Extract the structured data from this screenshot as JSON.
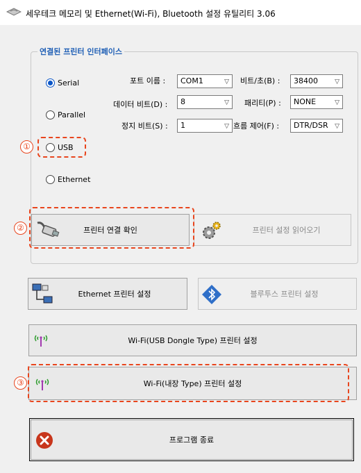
{
  "window": {
    "title": "세우테크 메모리 및 Ethernet(Wi-Fi), Bluetooth 설정 유틸리티 3.06"
  },
  "group": {
    "title": "연결된 프린터 인터페이스",
    "radios": [
      {
        "label": "Serial",
        "checked": true
      },
      {
        "label": "Parallel",
        "checked": false
      },
      {
        "label": "USB",
        "checked": false
      },
      {
        "label": "Ethernet",
        "checked": false
      }
    ],
    "fields": {
      "port": {
        "label": "포트 이름 :",
        "value": "COM1"
      },
      "baud": {
        "label": "비트/초(B) :",
        "value": "38400"
      },
      "databits": {
        "label": "데이터 비트(D) :",
        "value": "8"
      },
      "parity": {
        "label": "패리티(P) :",
        "value": "NONE"
      },
      "stopbits": {
        "label": "정지 비트(S) :",
        "value": "1"
      },
      "flow": {
        "label": "흐름 제어(F) :",
        "value": "DTR/DSR"
      }
    },
    "check_btn": "프린터 연결 확인",
    "read_btn": "프린터 설정 읽어오기"
  },
  "buttons": {
    "ethernet": "Ethernet 프린터 설정",
    "bluetooth": "블루투스 프린터 설정",
    "wifi_usb": "Wi-Fi(USB Dongle Type) 프린터 설정",
    "wifi_internal": "Wi-Fi(내장 Type) 프린터 설정",
    "exit": "프로그램 종료"
  },
  "annotations": {
    "n1": "①",
    "n2": "②",
    "n3": "③"
  },
  "colors": {
    "accent": "#e8451d",
    "group_title": "#1f5fb5",
    "radio_checked": "#0a55c7",
    "exit_icon": "#c8361c"
  },
  "icons": {
    "app": "printer-icon",
    "serial": "serial-cable-icon",
    "settings": "gear-icon",
    "ethernet": "network-computers-icon",
    "bluetooth": "bluetooth-icon",
    "wifi": "wifi-antenna-icon",
    "exit": "close-icon"
  }
}
